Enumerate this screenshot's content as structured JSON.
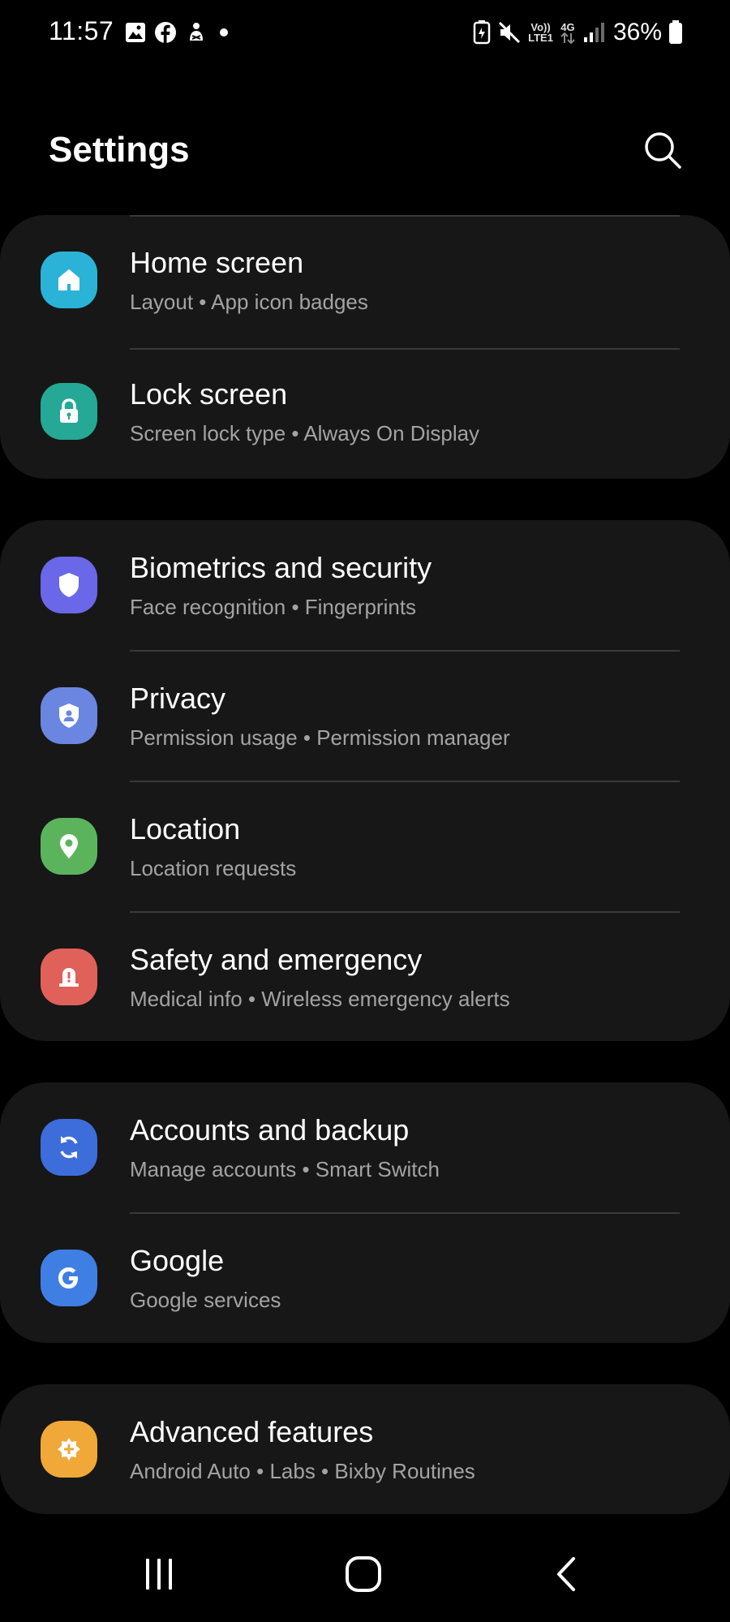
{
  "status_bar": {
    "time": "11:57",
    "notification_icons": [
      "gallery-icon",
      "facebook-icon",
      "game-icon",
      "dot-icon"
    ],
    "network_top": "Vo))",
    "network_bottom": "LTE1",
    "network_type": "4G",
    "battery_percent": "36%"
  },
  "header": {
    "title": "Settings"
  },
  "settings": {
    "home_screen": {
      "title": "Home screen",
      "subtitle": "Layout  •  App icon badges",
      "icon_color": "#2ab3d6"
    },
    "lock_screen": {
      "title": "Lock screen",
      "subtitle": "Screen lock type  •  Always On Display",
      "icon_color": "#25a896"
    },
    "biometrics": {
      "title": "Biometrics and security",
      "subtitle": "Face recognition  •  Fingerprints",
      "icon_color": "#6a67e8"
    },
    "privacy": {
      "title": "Privacy",
      "subtitle": "Permission usage  •  Permission manager",
      "icon_color": "#6b86e0"
    },
    "location": {
      "title": "Location",
      "subtitle": "Location requests",
      "icon_color": "#5bb45c"
    },
    "safety": {
      "title": "Safety and emergency",
      "subtitle": "Medical info  •  Wireless emergency alerts",
      "icon_color": "#e0615a"
    },
    "accounts": {
      "title": "Accounts and backup",
      "subtitle": "Manage accounts  •  Smart Switch",
      "icon_color": "#3d6ddb"
    },
    "google": {
      "title": "Google",
      "subtitle": "Google services",
      "icon_color": "#3f7fe3"
    },
    "advanced": {
      "title": "Advanced features",
      "subtitle": "Android Auto  •  Labs  •  Bixby Routines",
      "icon_color": "#f0a838"
    }
  },
  "nav": {
    "recents_icon": "recents-icon",
    "home_icon": "home-icon",
    "back_icon": "back-icon"
  }
}
